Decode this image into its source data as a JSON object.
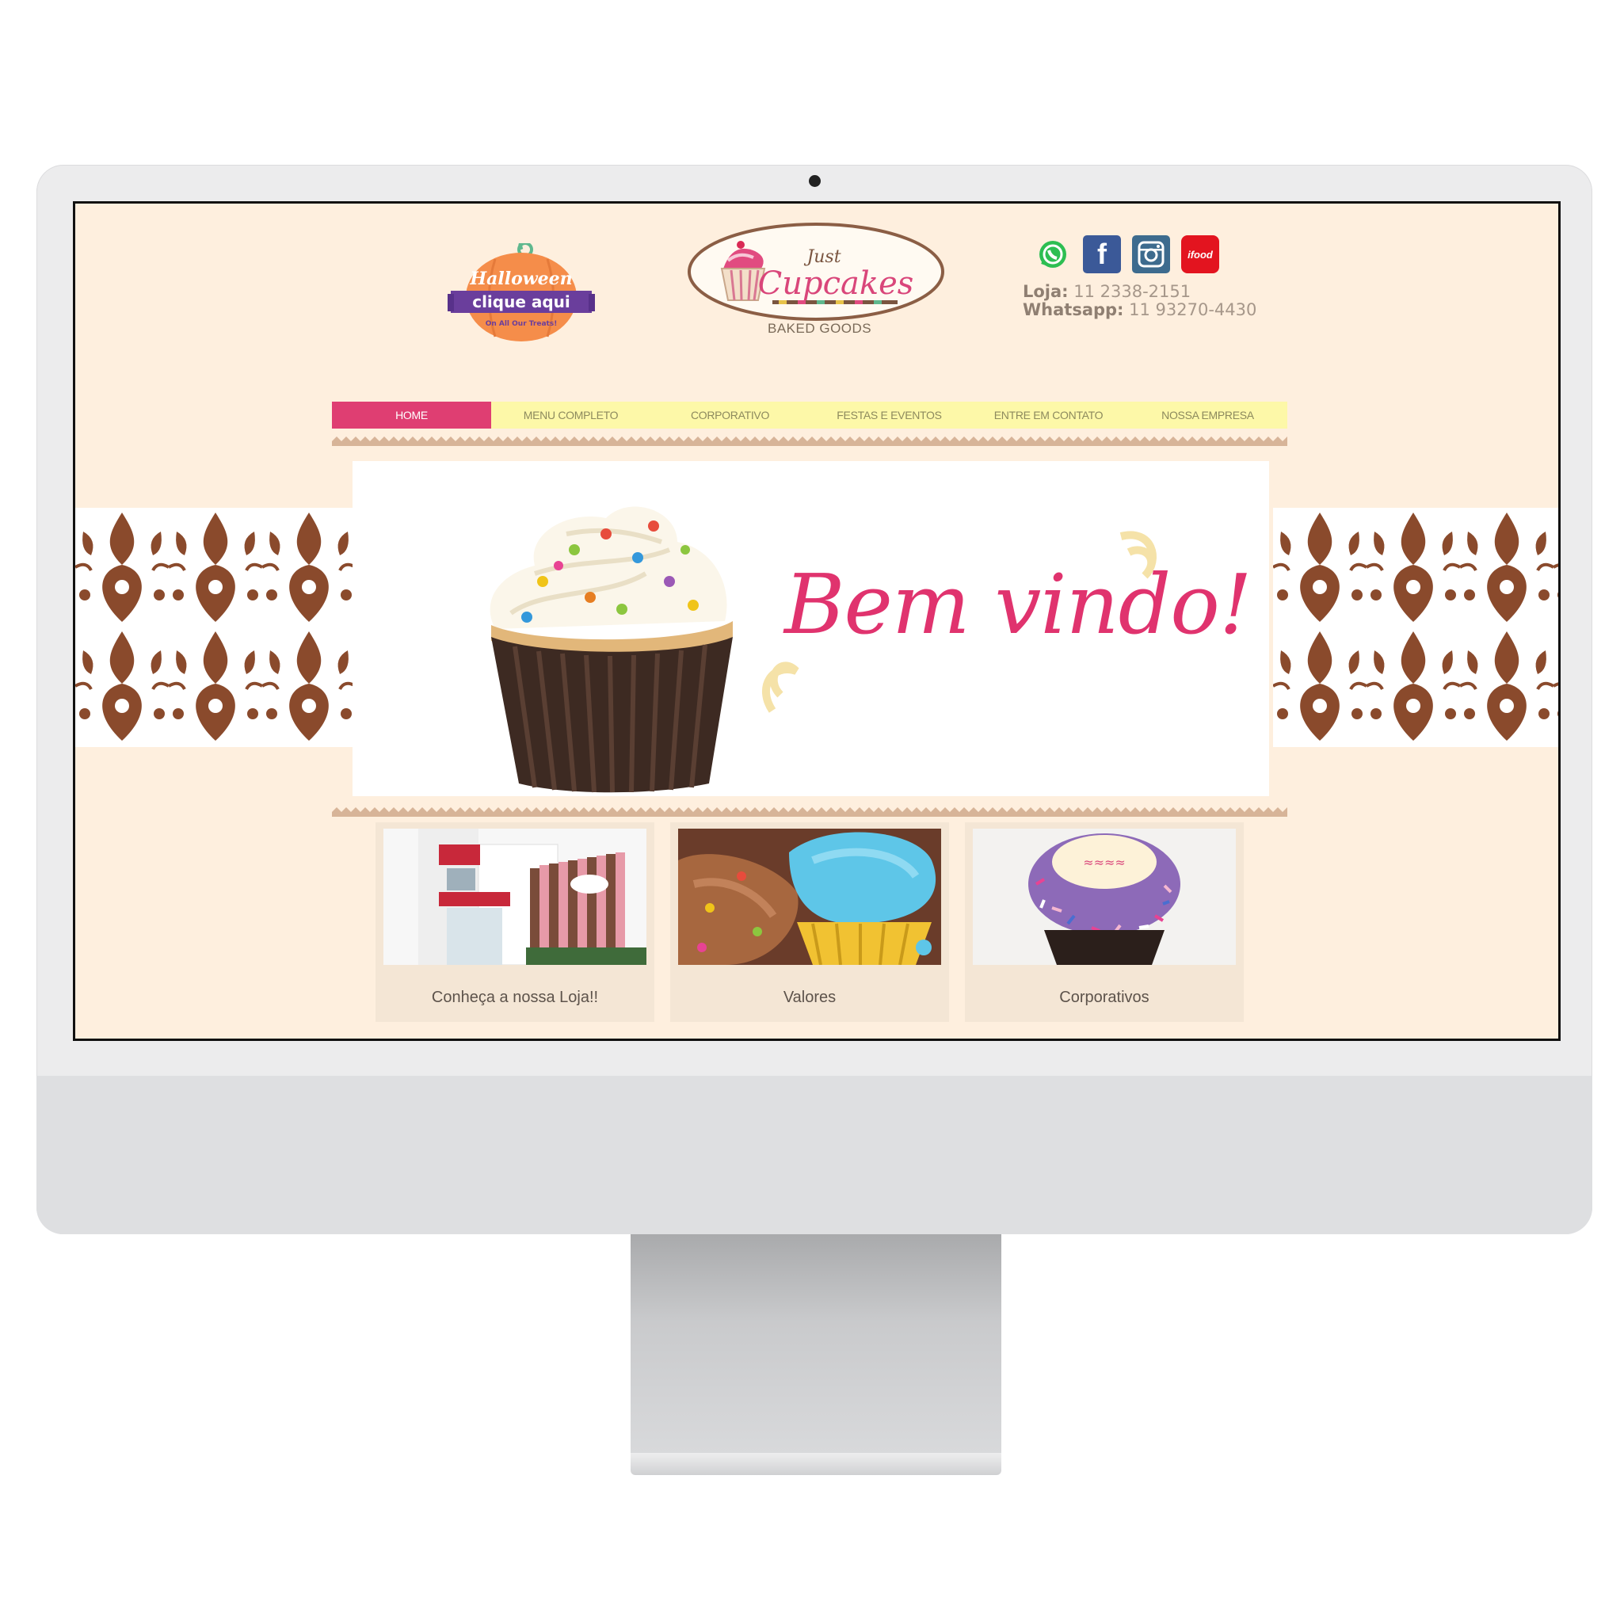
{
  "header": {
    "promo": {
      "title": "Halloween",
      "button": "clique aqui",
      "subtitle": "On All Our Treats!"
    },
    "logo": {
      "top": "Just",
      "main": "Cupcakes",
      "tagline": "BAKED GOODS"
    },
    "social": [
      {
        "name": "whatsapp-icon"
      },
      {
        "name": "facebook-icon",
        "glyph": "f"
      },
      {
        "name": "instagram-icon"
      },
      {
        "name": "ifood-icon",
        "glyph": "ifood"
      }
    ],
    "contact": {
      "store_label": "Loja:",
      "store_phone": "11 2338-2151",
      "whatsapp_label": "Whatsapp:",
      "whatsapp_phone": "11 93270-4430"
    }
  },
  "nav": {
    "items": [
      "HOME",
      "MENU COMPLETO",
      "CORPORATIVO",
      "FESTAS E EVENTOS",
      "ENTRE EM CONTATO",
      "NOSSA EMPRESA"
    ],
    "active_index": 0
  },
  "hero": {
    "text": "Bem vindo!"
  },
  "cards": [
    {
      "caption": "Conheça a nossa Loja!!"
    },
    {
      "caption": "Valores"
    },
    {
      "caption": "Corporativos"
    }
  ],
  "colors": {
    "accent": "#df3e72",
    "nav_bg": "#fdf8a8",
    "page_bg": "#feefde",
    "damask": "#8a4a2c"
  }
}
